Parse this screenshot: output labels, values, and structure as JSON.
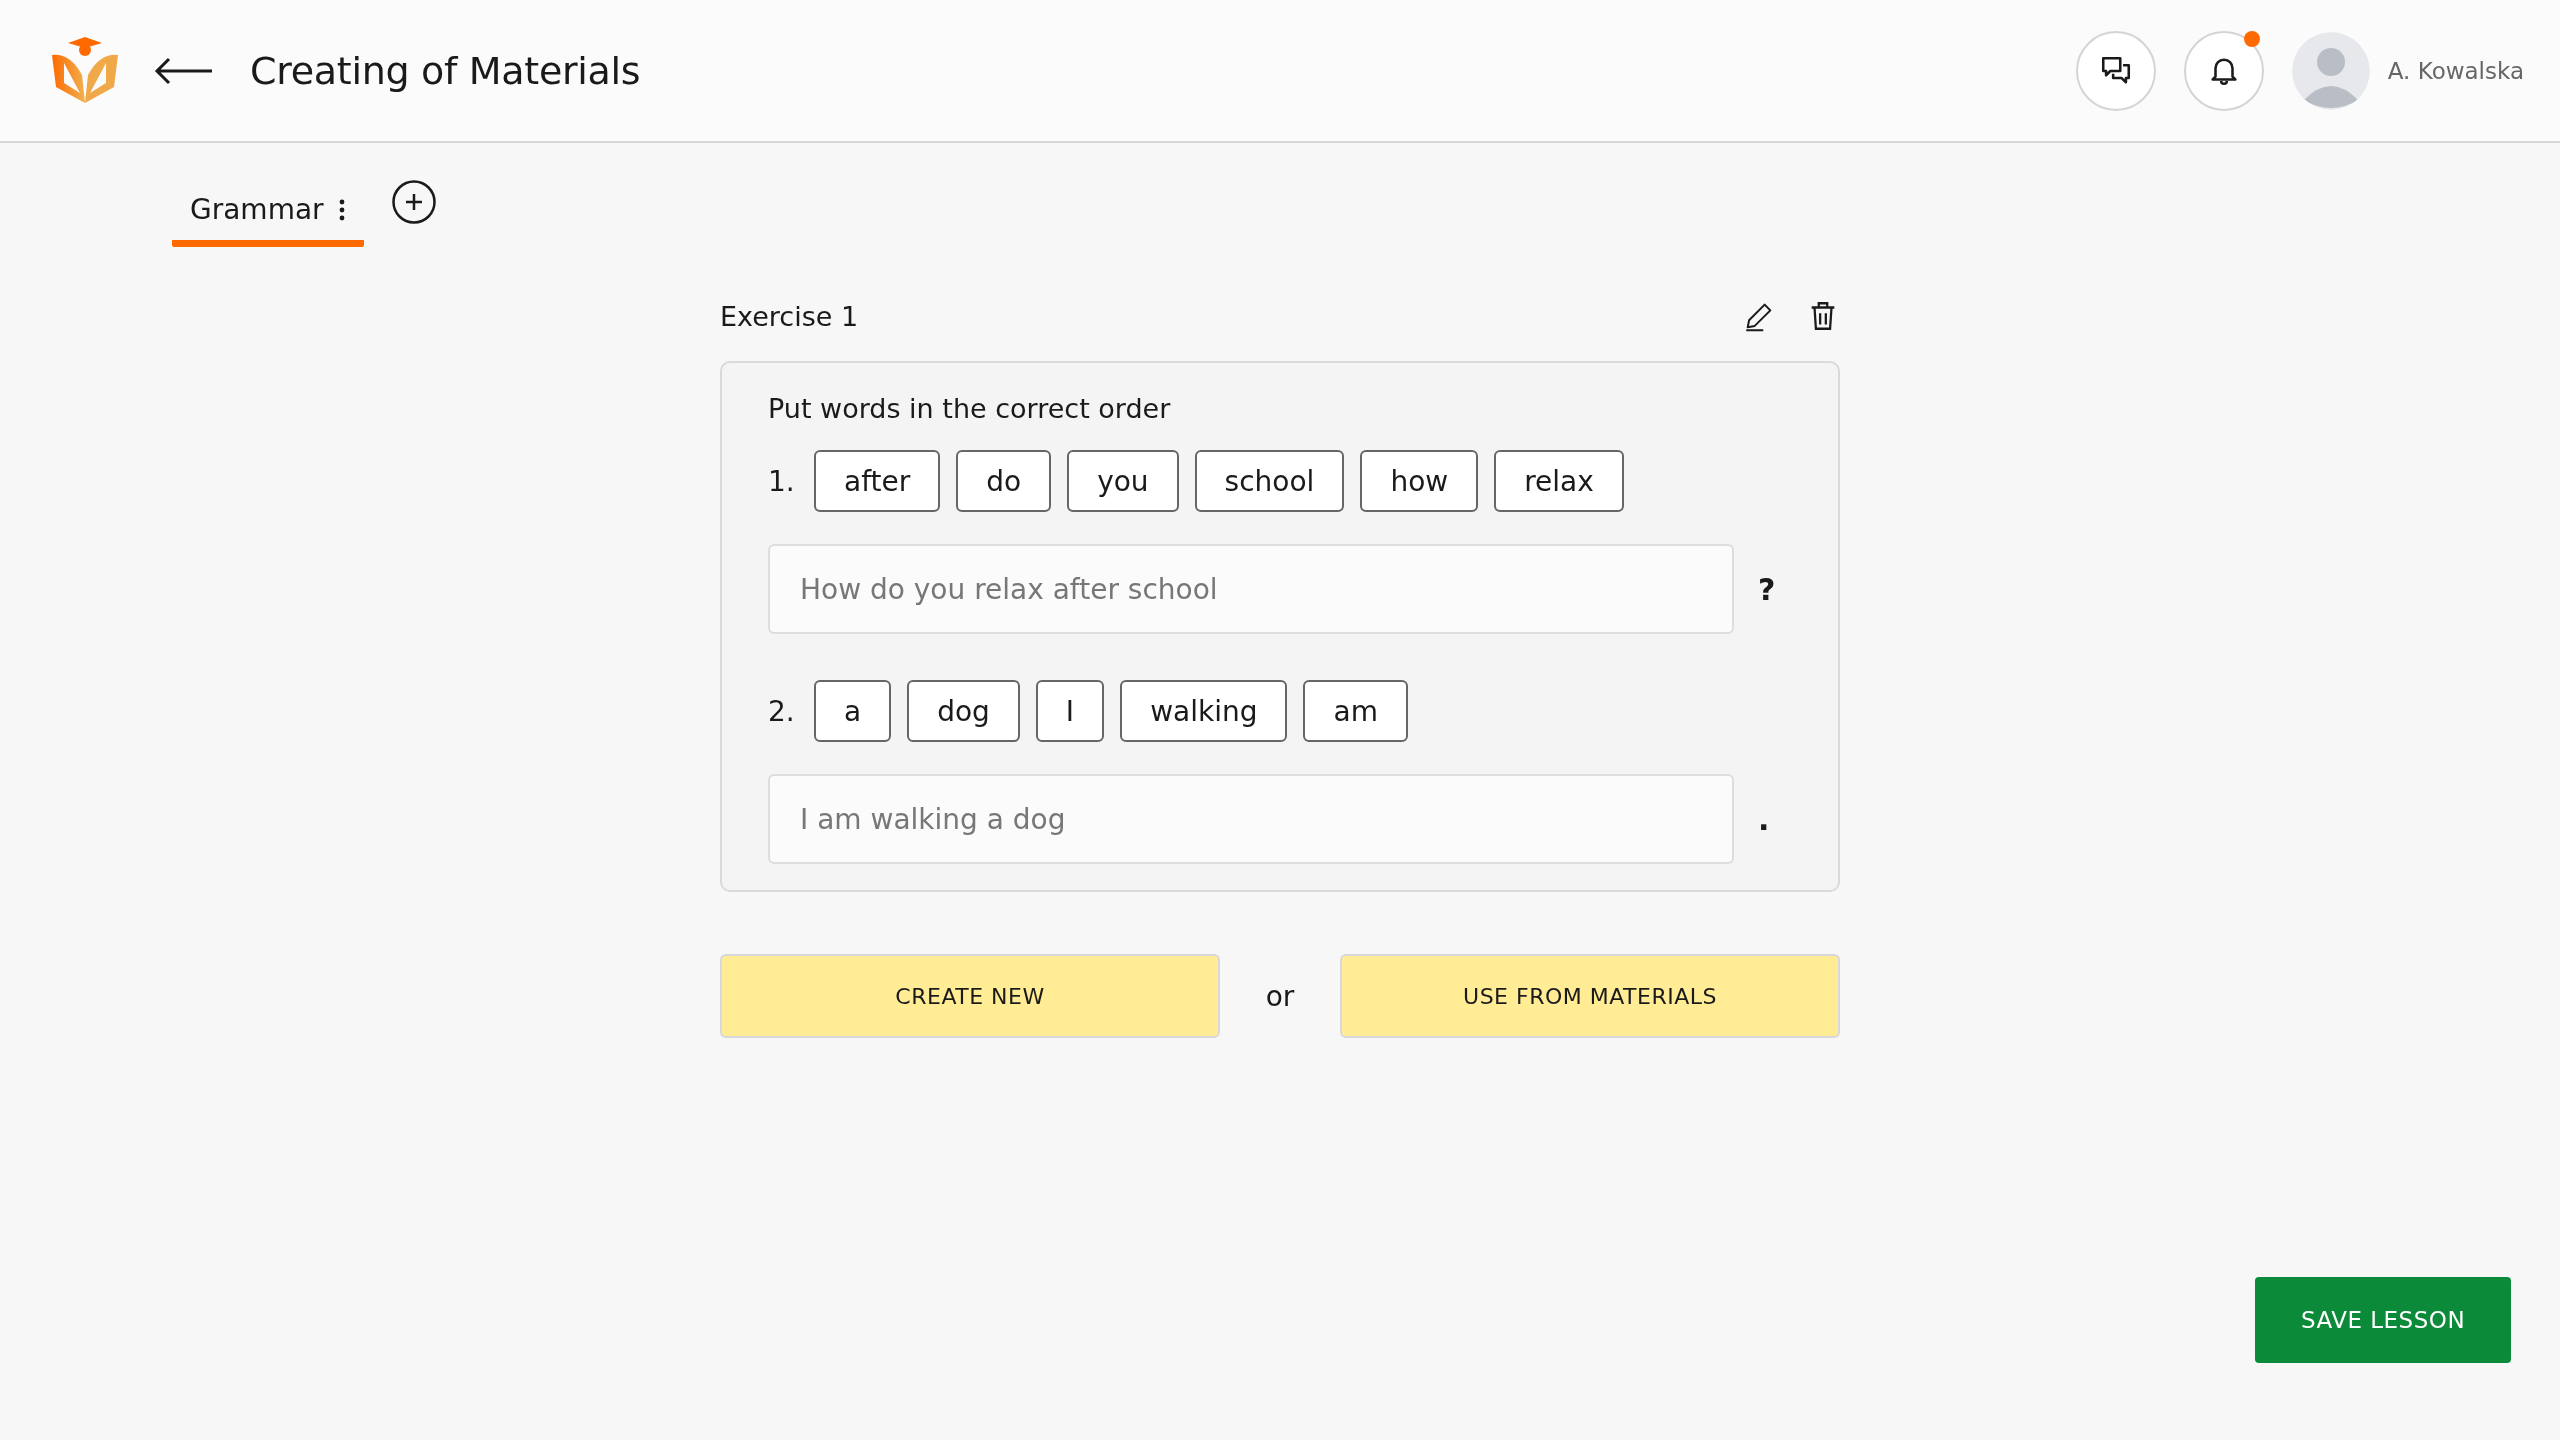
{
  "header": {
    "title": "Creating of Materials",
    "notification_unread": true,
    "user_name": "A. Kowalska"
  },
  "tabs": [
    {
      "label": "Grammar",
      "selected": true
    }
  ],
  "exercise": {
    "title": "Exercise 1",
    "instruction": "Put words in the correct order",
    "items": [
      {
        "number": "1.",
        "words": [
          "after",
          "do",
          "you",
          "school",
          "how",
          "relax"
        ],
        "placeholder": "How do you relax after school",
        "punctuation": "?"
      },
      {
        "number": "2.",
        "words": [
          "a",
          "dog",
          "I",
          "walking",
          "am"
        ],
        "placeholder": "I am walking a dog",
        "punctuation": "."
      }
    ]
  },
  "actions": {
    "create": "CREATE NEW",
    "separator": "or",
    "use": "USE FROM MATERIALS"
  },
  "save_button": "SAVE LESSON"
}
